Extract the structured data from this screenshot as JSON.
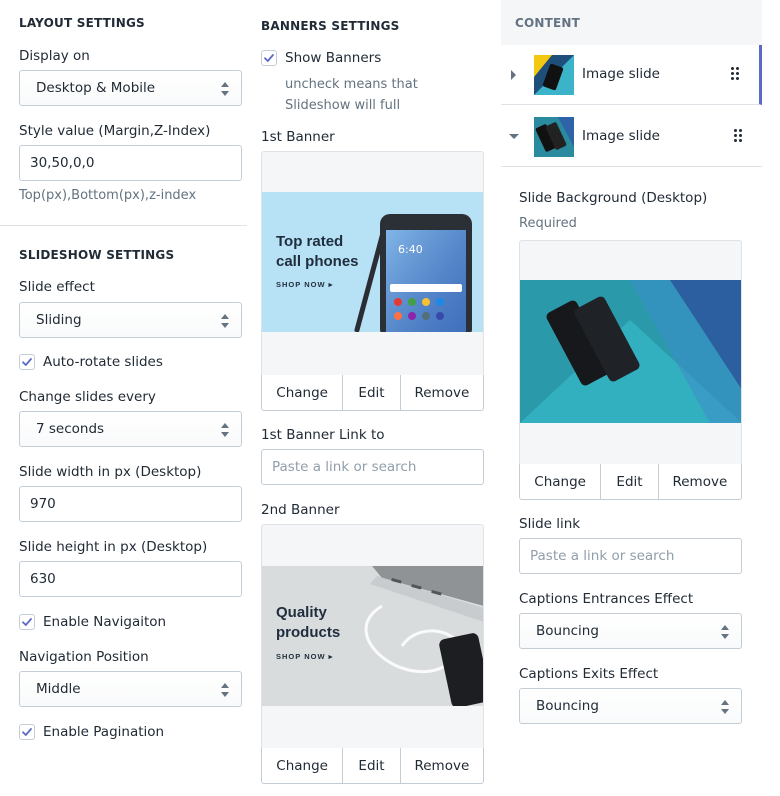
{
  "layout": {
    "heading": "LAYOUT SETTINGS",
    "display_on_label": "Display on",
    "display_on_value": "Desktop & Mobile",
    "style_label": "Style value (Margin,Z-Index)",
    "style_value": "30,50,0,0",
    "style_hint": "Top(px),Bottom(px),z-index"
  },
  "slideshow": {
    "heading": "SLIDESHOW SETTINGS",
    "effect_label": "Slide effect",
    "effect_value": "Sliding",
    "autorotate_label": "Auto-rotate slides",
    "autorotate_checked": true,
    "change_label": "Change slides every",
    "change_value": "7 seconds",
    "width_label": "Slide width in px (Desktop)",
    "width_value": "970",
    "height_label": "Slide height in px (Desktop)",
    "height_value": "630",
    "nav_label": "Enable Navigaiton",
    "nav_checked": true,
    "nav_pos_label": "Navigation Position",
    "nav_pos_value": "Middle",
    "pagination_label": "Enable Pagination",
    "pagination_checked": true
  },
  "banners": {
    "heading": "BANNERS SETTINGS",
    "show_label": "Show Banners",
    "show_checked": true,
    "show_hint": "uncheck means that Slideshow will full",
    "banner1_label": "1st Banner",
    "banner1_title": "Top rated call phones",
    "banner1_line1": "Top rated",
    "banner1_line2": "call phones",
    "banner1_cta": "SHOP NOW ▸",
    "banner1_phone_time": "6:40",
    "banner1_link_label": "1st Banner Link to",
    "banner1_link_placeholder": "Paste a link or search",
    "banner2_label": "2nd Banner",
    "banner2_line1": "Quality",
    "banner2_line2": "products",
    "banner2_cta": "SHOP NOW ▸",
    "change": "Change",
    "edit": "Edit",
    "remove": "Remove"
  },
  "content": {
    "heading": "CONTENT",
    "slides": [
      {
        "title": "Image slide",
        "expanded": false
      },
      {
        "title": "Image slide",
        "expanded": true
      }
    ],
    "bg_label": "Slide Background (Desktop)",
    "bg_hint": "Required",
    "change": "Change",
    "edit": "Edit",
    "remove": "Remove",
    "link_label": "Slide link",
    "link_placeholder": "Paste a link or search",
    "entrance_label": "Captions Entrances Effect",
    "entrance_value": "Bouncing",
    "exit_label": "Captions Exits Effect",
    "exit_value": "Bouncing"
  },
  "colors": {
    "accent": "#5c6ac4",
    "text": "#212b36",
    "muted": "#637381",
    "border": "#c4cdd5",
    "banner1_bg": "#b7e1f5",
    "banner2_bg": "#d9dcdd"
  }
}
